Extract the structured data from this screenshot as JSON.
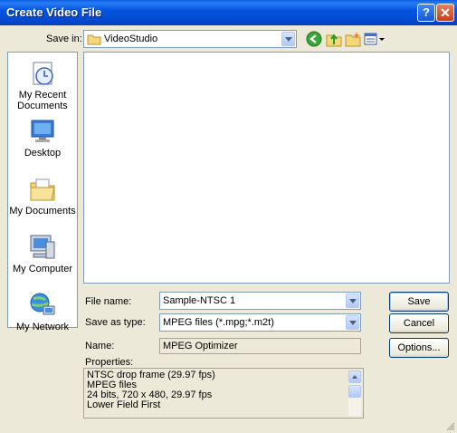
{
  "window": {
    "title": "Create Video File",
    "help_label": "?",
    "close_label": "✕"
  },
  "save_in": {
    "label": "Save in:",
    "value": "VideoStudio"
  },
  "toolbar": {
    "icons": [
      "back-icon",
      "up-folder-icon",
      "new-folder-icon",
      "views-menu-icon"
    ]
  },
  "places": [
    {
      "label": "My Recent\nDocuments",
      "icon": "recent-documents-icon"
    },
    {
      "label": "Desktop",
      "icon": "desktop-icon"
    },
    {
      "label": "My Documents",
      "icon": "my-documents-icon"
    },
    {
      "label": "My Computer",
      "icon": "my-computer-icon"
    },
    {
      "label": "My Network",
      "icon": "my-network-icon"
    }
  ],
  "file_name": {
    "label": "File name:",
    "value": "Sample-NTSC 1"
  },
  "save_as_type": {
    "label": "Save as type:",
    "value": "MPEG files (*.mpg;*.m2t)"
  },
  "name_field": {
    "label": "Name:",
    "value": "MPEG Optimizer"
  },
  "properties": {
    "label": "Properties:",
    "lines": [
      "NTSC drop frame (29.97 fps)",
      "MPEG files",
      "24 bits, 720 x 480, 29.97 fps",
      "Lower Field First"
    ]
  },
  "buttons": {
    "save": "Save",
    "cancel": "Cancel",
    "options": "Options..."
  },
  "colors": {
    "titlebar": "#0554e0",
    "dialog_bg": "#ece9d8",
    "field_border": "#7f9db9"
  }
}
